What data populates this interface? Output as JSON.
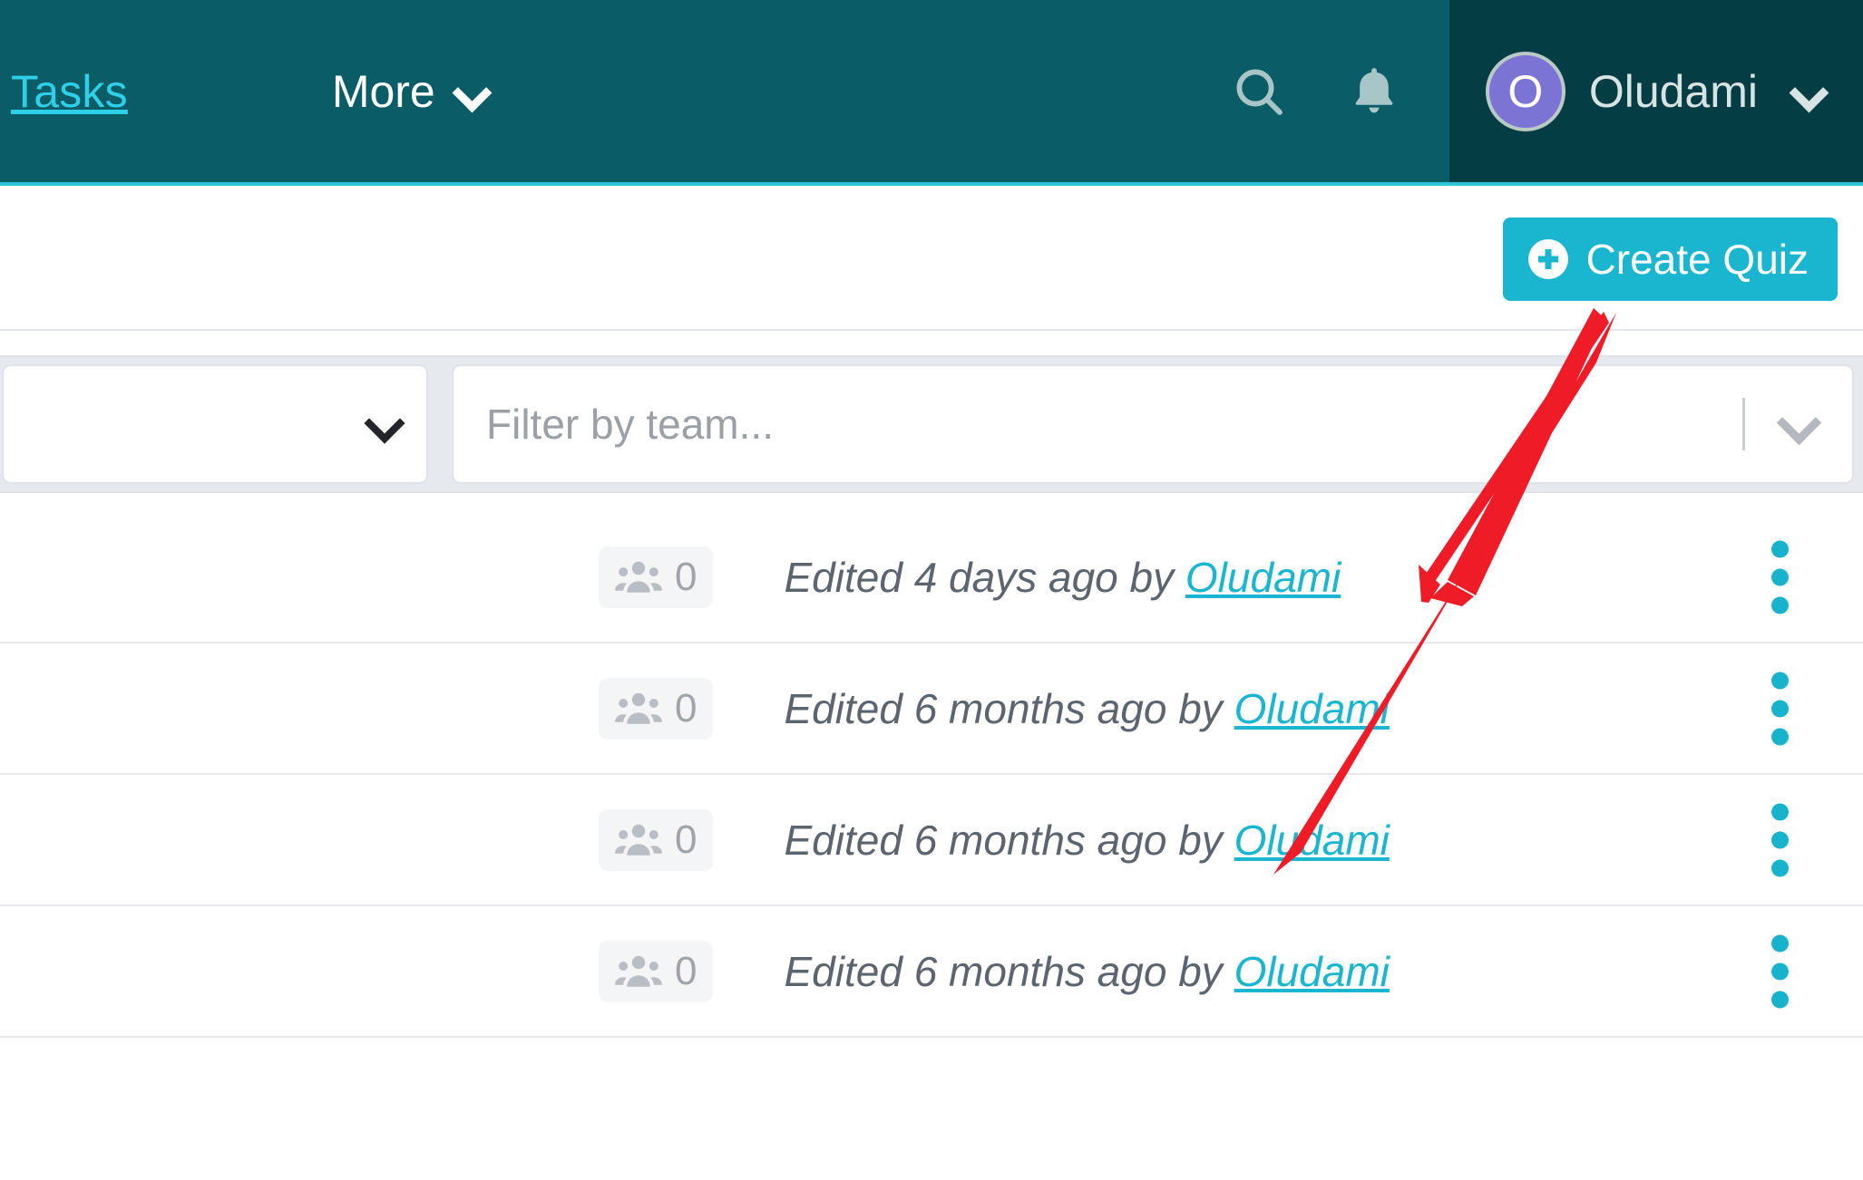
{
  "navbar": {
    "tasks_label": "Tasks",
    "more_label": "More",
    "search_icon": "search-icon",
    "bell_icon": "bell-icon",
    "user": {
      "avatar_initial": "O",
      "name": "Oludami"
    },
    "colors": {
      "bar_bg": "#0a5c66",
      "user_chip_bg": "#043d44",
      "underline": "#2cc6da",
      "link_cyan": "#2ed0e8",
      "avatar_bg": "#7b74d4"
    }
  },
  "actions": {
    "create_quiz_label": "Create Quiz",
    "create_quiz_icon": "plus-circle-icon",
    "accent": "#1ab5cf"
  },
  "filters": {
    "sort_select_value": "",
    "team_placeholder": "Filter by team...",
    "team_value": "",
    "chevron_icon": "chevron-down-icon"
  },
  "list": {
    "rows": [
      {
        "participants_count": "0",
        "participants_icon": "users-icon",
        "edited_prefix": "Edited 4 days ago by ",
        "edited_author": "Oludami",
        "menu_icon": "kebab-menu-icon"
      },
      {
        "participants_count": "0",
        "participants_icon": "users-icon",
        "edited_prefix": "Edited 6 months ago by ",
        "edited_author": "Oludami",
        "menu_icon": "kebab-menu-icon"
      },
      {
        "participants_count": "0",
        "participants_icon": "users-icon",
        "edited_prefix": "Edited 6 months ago by ",
        "edited_author": "Oludami",
        "menu_icon": "kebab-menu-icon"
      },
      {
        "participants_count": "0",
        "participants_icon": "users-icon",
        "edited_prefix": "Edited 6 months ago by ",
        "edited_author": "Oludami",
        "menu_icon": "kebab-menu-icon"
      }
    ]
  },
  "annotation": {
    "arrow_icon": "red-arrow-annotation",
    "arrow_color": "#ef1c28",
    "points_to": "Create Quiz"
  }
}
